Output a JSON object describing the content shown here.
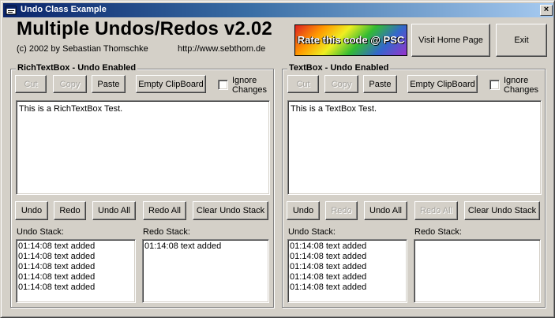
{
  "window": {
    "title": "Undo Class Example",
    "close_label": "×"
  },
  "header": {
    "heading": "Multiple Undos/Redos v2.02",
    "copyright": "(c) 2002 by Sebastian Thomschke",
    "url": "http://www.sebthom.de",
    "rate_banner": "Rate this code @ PSC",
    "visit_button": "Visit Home Page",
    "exit_button": "Exit"
  },
  "left_panel": {
    "title": "RichTextBox - Undo Enabled",
    "cut": "Cut",
    "copy": "Copy",
    "paste": "Paste",
    "empty_clipboard": "Empty ClipBoard",
    "ignore_changes": "Ignore Changes",
    "ignore_checked": false,
    "text": "This is a RichTextBox Test.",
    "undo": "Undo",
    "redo": "Redo",
    "undo_all": "Undo All",
    "redo_all": "Redo All",
    "clear_undo_stack": "Clear Undo Stack",
    "undo_stack_label": "Undo Stack:",
    "redo_stack_label": "Redo Stack:",
    "undo_stack": [
      "01:14:08 text added",
      "01:14:08 text added",
      "01:14:08 text added",
      "01:14:08 text added",
      "01:14:08 text added"
    ],
    "redo_stack": [
      "01:14:08 text added"
    ]
  },
  "right_panel": {
    "title": "TextBox - Undo Enabled",
    "cut": "Cut",
    "copy": "Copy",
    "paste": "Paste",
    "empty_clipboard": "Empty ClipBoard",
    "ignore_changes": "Ignore Changes",
    "ignore_checked": false,
    "text": "This is a TextBox Test.",
    "undo": "Undo",
    "redo": "Redo",
    "undo_all": "Undo All",
    "redo_all": "Redo All",
    "clear_undo_stack": "Clear Undo Stack",
    "undo_stack_label": "Undo Stack:",
    "redo_stack_label": "Redo Stack:",
    "undo_stack": [
      "01:14:08 text added",
      "01:14:08 text added",
      "01:14:08 text added",
      "01:14:08 text added",
      "01:14:08 text added"
    ],
    "redo_stack": []
  }
}
